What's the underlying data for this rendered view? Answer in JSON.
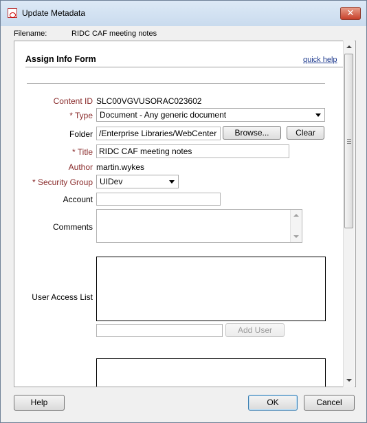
{
  "window": {
    "title": "Update Metadata",
    "close_glyph": "✕"
  },
  "filename": {
    "label": "Filename:",
    "value": "RIDC CAF meeting notes"
  },
  "form": {
    "title": "Assign Info Form",
    "quick_help": "quick help",
    "fields": {
      "content_id": {
        "label": "Content ID",
        "value": "SLC00VGVUSORAC023602"
      },
      "type": {
        "label": "* Type",
        "value": "Document - Any generic document"
      },
      "folder": {
        "label": "Folder",
        "value": "/Enterprise Libraries/WebCenter",
        "browse": "Browse...",
        "clear": "Clear"
      },
      "title": {
        "label": "* Title",
        "value": "RIDC CAF meeting notes"
      },
      "author": {
        "label": "Author",
        "value": "martin.wykes"
      },
      "security_group": {
        "label": "* Security Group",
        "value": "UIDev"
      },
      "account": {
        "label": "Account",
        "value": ""
      },
      "comments": {
        "label": "Comments",
        "value": ""
      },
      "user_access_list": {
        "label": "User Access List",
        "add_user": "Add User",
        "input_value": ""
      }
    }
  },
  "footer": {
    "help": "Help",
    "ok": "OK",
    "cancel": "Cancel"
  },
  "colors": {
    "required_label": "#8a2c2c",
    "link": "#1f3b8f",
    "title_bar": "#dde9f6",
    "close_button": "#c8402a"
  },
  "icons": {
    "app": "document-app-icon",
    "close": "close-icon",
    "dropdown": "chevron-down-icon"
  }
}
